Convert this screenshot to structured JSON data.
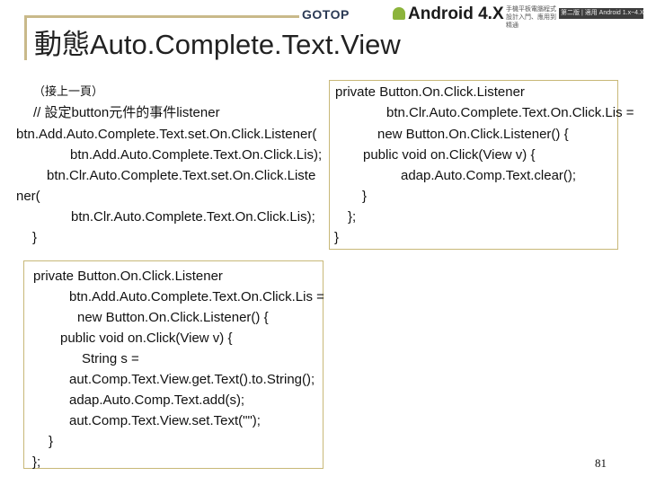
{
  "slide": {
    "title": "動態Auto.Complete.Text.View",
    "page_number": "81"
  },
  "header": {
    "publisher": "GOTOP",
    "book_title": "Android 4.X",
    "book_subtitle": "手機平板電腦程式設計入門、應用到精通",
    "edition_strip": "第二版 | 適用 Android 1.x~4.X"
  },
  "code_continued": {
    "lines": [
      "（接上一頁）",
      "// 設定button元件的事件listener",
      "btn.Add.Auto.Complete.Text.set.On.Click.Listener(",
      "btn.Add.Auto.Complete.Text.On.Click.Lis);",
      "btn.Clr.Auto.Complete.Text.set.On.Click.Liste",
      "ner(",
      "btn.Clr.Auto.Complete.Text.On.Click.Lis);",
      "}"
    ]
  },
  "code_add_listener": {
    "lines": [
      "private Button.On.Click.Listener",
      "btn.Add.Auto.Complete.Text.On.Click.Lis =",
      "new Button.On.Click.Listener() {",
      "public void on.Click(View v) {",
      "String s =",
      "aut.Comp.Text.View.get.Text().to.String();",
      "adap.Auto.Comp.Text.add(s);",
      "aut.Comp.Text.View.set.Text(\"\");",
      "}",
      "};"
    ]
  },
  "code_clr_listener": {
    "lines": [
      "private Button.On.Click.Listener",
      "btn.Clr.Auto.Complete.Text.On.Click.Lis =",
      "new Button.On.Click.Listener() {",
      "public void on.Click(View v) {",
      "adap.Auto.Comp.Text.clear();",
      "}",
      "};",
      "}"
    ]
  },
  "colors": {
    "box_border": "#c8b878",
    "title_rule": "#c9b98a",
    "brand_green": "#6aa52b"
  }
}
